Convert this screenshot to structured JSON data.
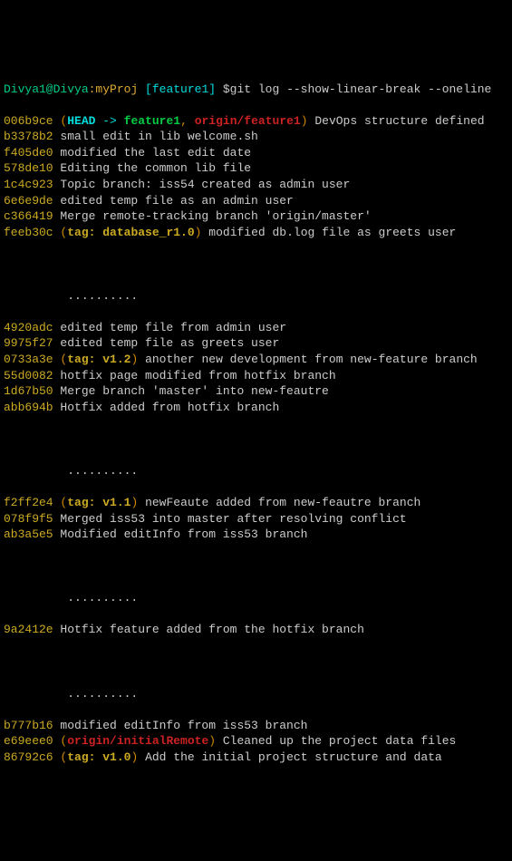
{
  "prompt": {
    "user": "Divya1@Divya",
    "path": ":myProj",
    "branch": " [feature1]",
    "cmd": " $git log --show-linear-break --oneline"
  },
  "break": "         ..........",
  "commits": [
    {
      "hash": "006b9ce",
      "refs": {
        "head": "HEAD",
        "arrow": " -> ",
        "local": "feature1",
        "sep": ", ",
        "remote": "origin/feature1"
      },
      "msg": " DevOps structure defined"
    },
    {
      "hash": "b3378b2",
      "msg": " small edit in lib welcome.sh"
    },
    {
      "hash": "f405de0",
      "msg": " modified the last edit date"
    },
    {
      "hash": "578de10",
      "msg": " Editing the common lib file"
    },
    {
      "hash": "1c4c923",
      "msg": " Topic branch: iss54 created as admin user"
    },
    {
      "hash": "6e6e9de",
      "msg": " edited temp file as an admin user"
    },
    {
      "hash": "c366419",
      "msg": " Merge remote-tracking branch 'origin/master'"
    },
    {
      "hash": "feeb30c",
      "tag": "tag: database_r1.0",
      "msg": " modified db.log file as greets user"
    }
  ],
  "commits2": [
    {
      "hash": "4920adc",
      "msg": " edited temp file from admin user"
    },
    {
      "hash": "9975f27",
      "msg": " edited temp file as greets user"
    },
    {
      "hash": "0733a3e",
      "tag": "tag: v1.2",
      "msg": " another new development from new-feature branch"
    },
    {
      "hash": "55d0082",
      "msg": " hotfix page modified from hotfix branch"
    },
    {
      "hash": "1d67b50",
      "msg": " Merge branch 'master' into new-feautre"
    },
    {
      "hash": "abb694b",
      "msg": " Hotfix added from hotfix branch"
    }
  ],
  "commits3": [
    {
      "hash": "f2ff2e4",
      "tag": "tag: v1.1",
      "msg": " newFeaute added from new-feautre branch"
    },
    {
      "hash": "078f9f5",
      "msg": " Merged iss53 into master after resolving conflict"
    },
    {
      "hash": "ab3a5e5",
      "msg": " Modified editInfo from iss53 branch"
    }
  ],
  "commits4": [
    {
      "hash": "9a2412e",
      "msg": " Hotfix feature added from the hotfix branch"
    }
  ],
  "commits5": [
    {
      "hash": "b777b16",
      "msg": " modified editInfo from iss53 branch"
    },
    {
      "hash": "e69eee0",
      "remote": "origin/initialRemote",
      "msg": " Cleaned up the project data files"
    },
    {
      "hash": "86792c6",
      "tag": "tag: v1.0",
      "msg": " Add the initial project structure and data"
    }
  ]
}
